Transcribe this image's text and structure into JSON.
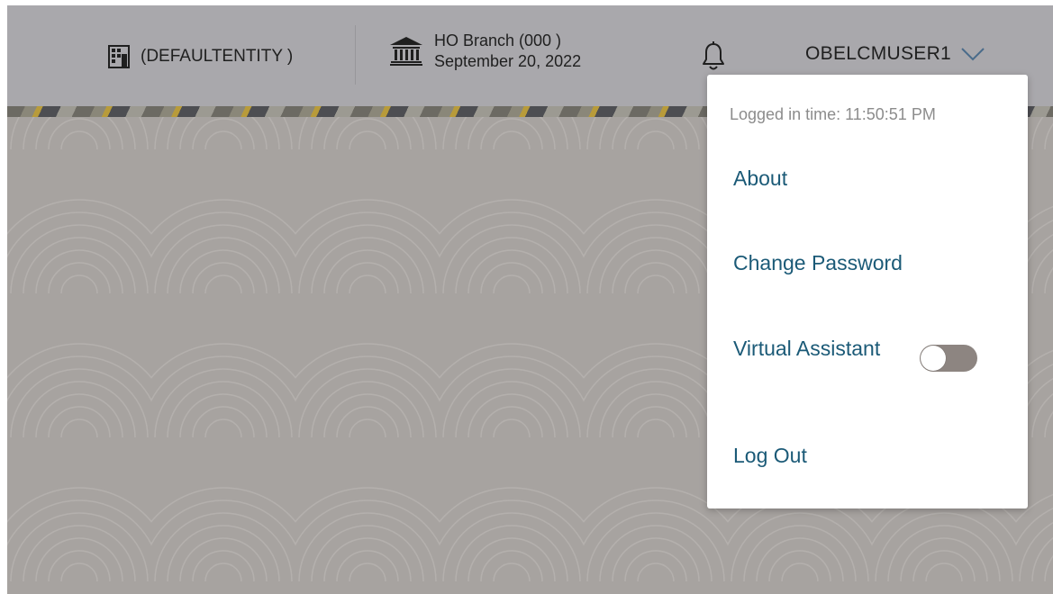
{
  "header": {
    "entity_label": "(DEFAULTENTITY )",
    "branch_name": "HO Branch (000 )",
    "branch_date": "September 20, 2022",
    "username": "OBELCMUSER1"
  },
  "user_menu": {
    "logged_in_time": "Logged in time: 11:50:51 PM",
    "items": {
      "about": "About",
      "change_password": "Change Password",
      "virtual_assistant": "Virtual Assistant",
      "log_out": "Log Out"
    },
    "virtual_assistant_enabled": false
  },
  "colors": {
    "link": "#1b5a77",
    "topbar": "#a9a8ac",
    "overlay_background": "#a7a3a0",
    "toggle_off": "#8d8581"
  },
  "icons": {
    "entity": "building-icon",
    "branch": "bank-icon",
    "notifications": "bell-icon",
    "user_dropdown": "chevron-down-icon"
  }
}
